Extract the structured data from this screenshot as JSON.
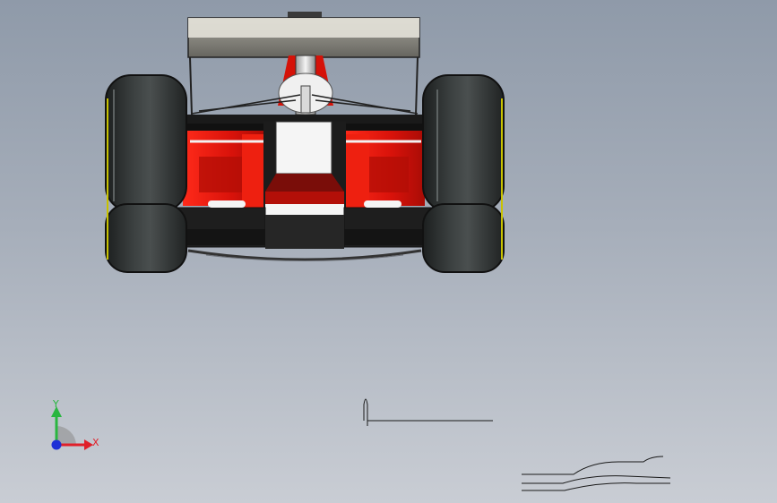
{
  "viewport": {
    "model": "formula-car-rear-view",
    "colors": {
      "background_top": "#8f9aa9",
      "background_bottom": "#c9cdd4",
      "tire": "#2f3333",
      "chassis_red": "#e8160c",
      "wing_grey": "#7b7a72",
      "white": "#f2f2f2"
    }
  },
  "triad": {
    "x_label": "X",
    "y_label": "Y",
    "x_color": "#e0202a",
    "y_color": "#2ab640",
    "z_color": "#1e2fd6"
  }
}
